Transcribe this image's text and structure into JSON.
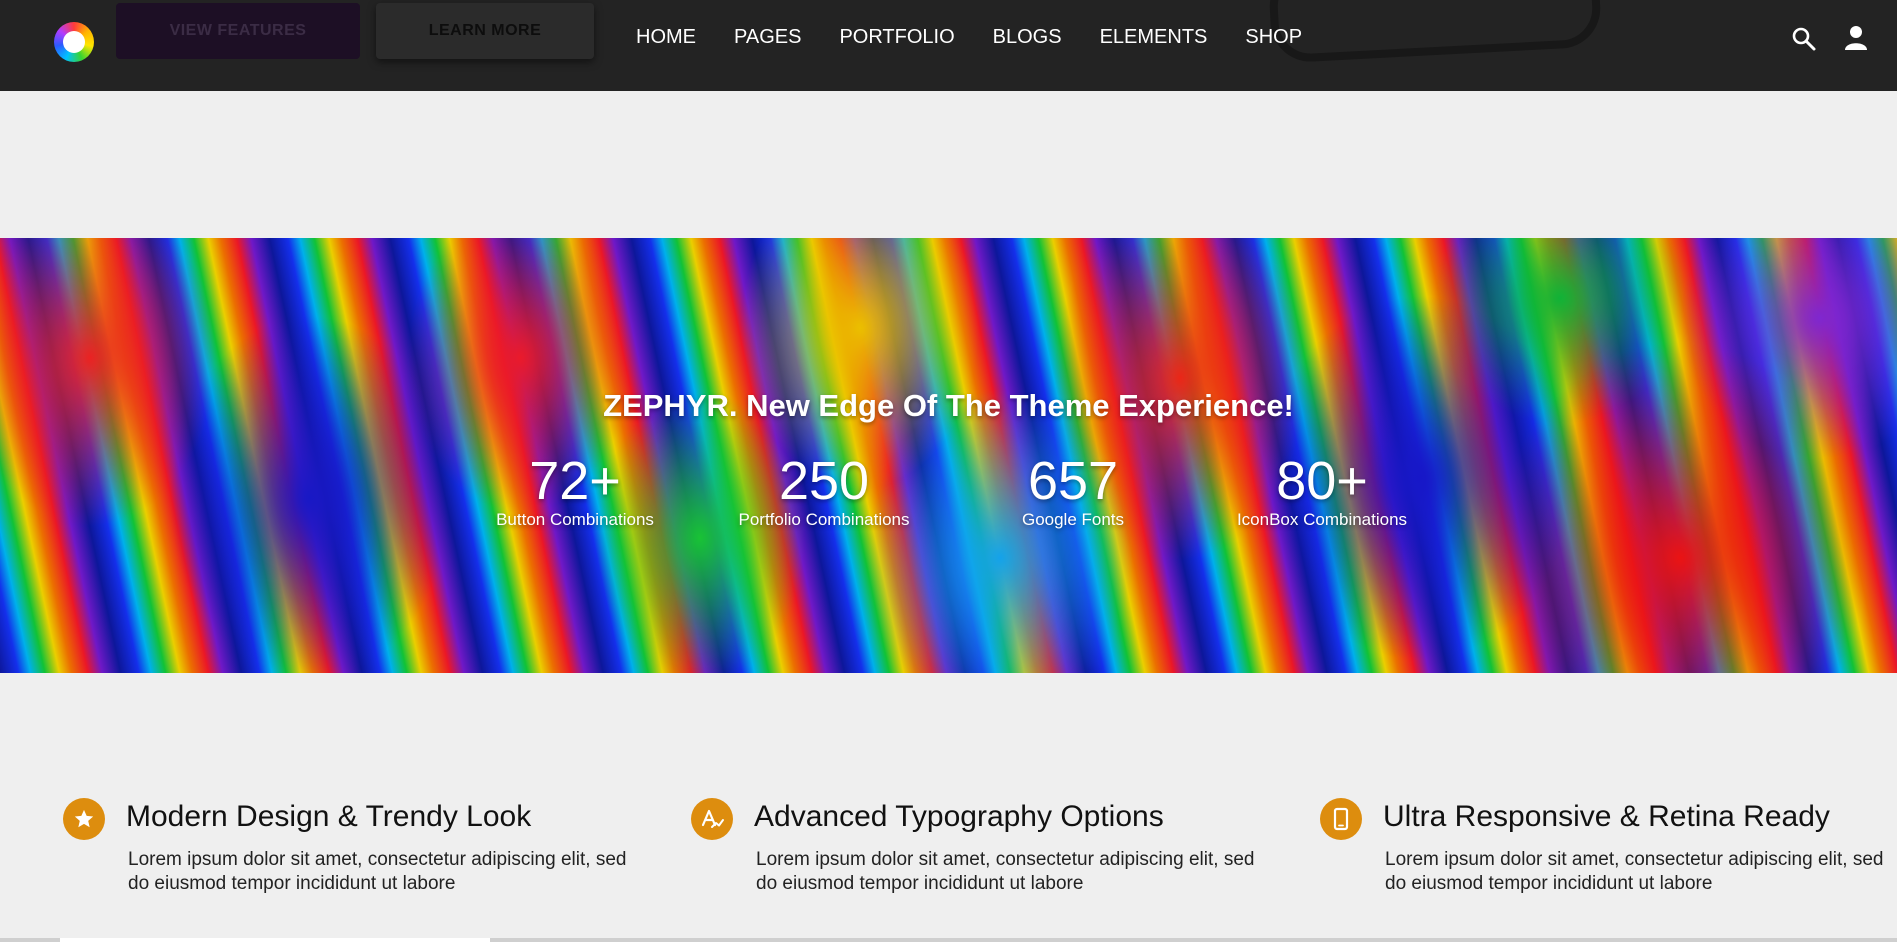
{
  "header": {
    "buttons": {
      "view_features": "VIEW FEATURES",
      "learn_more": "LEARN MORE"
    },
    "nav": [
      {
        "label": "HOME"
      },
      {
        "label": "PAGES"
      },
      {
        "label": "PORTFOLIO"
      },
      {
        "label": "BLOGS"
      },
      {
        "label": "ELEMENTS"
      },
      {
        "label": "SHOP"
      }
    ],
    "icons": {
      "search": "search-icon",
      "user": "user-icon",
      "logo": "logo-icon"
    }
  },
  "hero": {
    "title_brand": "ZEPHYR.",
    "title_rest": " New Edge Of The Theme Experience!",
    "stats": [
      {
        "number": "72+",
        "label": "Button Combinations"
      },
      {
        "number": "250",
        "label": "Portfolio Combinations"
      },
      {
        "number": "657",
        "label": "Google Fonts"
      },
      {
        "number": "80+",
        "label": "IconBox Combinations"
      }
    ]
  },
  "features": [
    {
      "icon": "star-icon",
      "title": "Modern Design & Trendy Look",
      "text": "Lorem ipsum dolor sit amet, consectetur adipiscing elit, sed do eiusmod tempor incididunt ut labore"
    },
    {
      "icon": "typography-icon",
      "title": "Advanced Typography Options",
      "text": "Lorem ipsum dolor sit amet, consectetur adipiscing elit, sed do eiusmod tempor incididunt ut labore"
    },
    {
      "icon": "mobile-icon",
      "title": "Ultra Responsive & Retina Ready",
      "text": "Lorem ipsum dolor sit amet, consectetur adipiscing elit, sed do eiusmod tempor incididunt ut labore"
    }
  ],
  "colors": {
    "header_bg": "#232323",
    "accent": "#dd8d0e",
    "page_bg": "#efefef"
  }
}
